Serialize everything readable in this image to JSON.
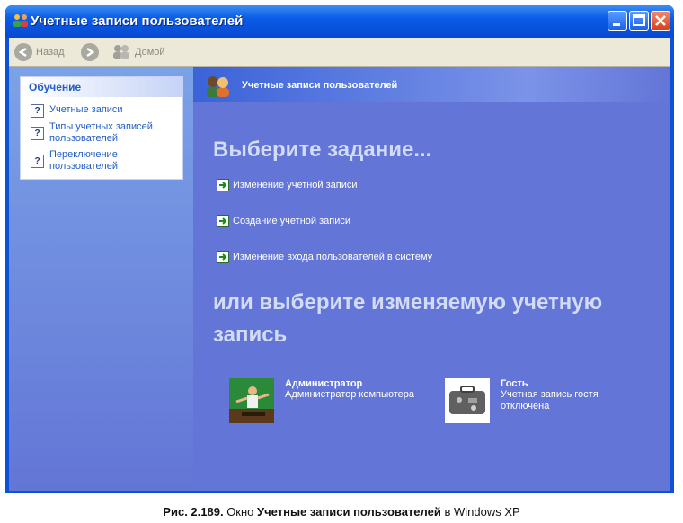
{
  "window": {
    "title": "Учетные записи пользователей"
  },
  "toolbar": {
    "back_label": "Назад",
    "home_label": "Домой"
  },
  "sidebar": {
    "panel_title": "Обучение",
    "items": [
      {
        "label_lines": [
          "Учетные записи"
        ]
      },
      {
        "label_lines": [
          "Типы учетных записей",
          "пользователей"
        ]
      },
      {
        "label_lines": [
          "Переключение",
          "пользователей"
        ]
      }
    ]
  },
  "main": {
    "header_title": "Учетные записи пользователей",
    "pick_task": "Выберите задание...",
    "tasks": [
      "Изменение учетной записи",
      "Создание учетной записи",
      "Изменение входа пользователей в систему"
    ],
    "pick_account_line1": "или выберите изменяемую учетную",
    "pick_account_line2": "запись",
    "accounts": [
      {
        "name": "Администратор",
        "desc_lines": [
          "Администратор компьютера"
        ]
      },
      {
        "name": "Гость",
        "desc_lines": [
          "Учетная запись гостя",
          "отключена"
        ]
      }
    ]
  },
  "caption": {
    "fig": "Рис. 2.189.",
    "pre": "Окно",
    "bold": "Учетные записи пользователей",
    "post": "в Windows XP"
  }
}
